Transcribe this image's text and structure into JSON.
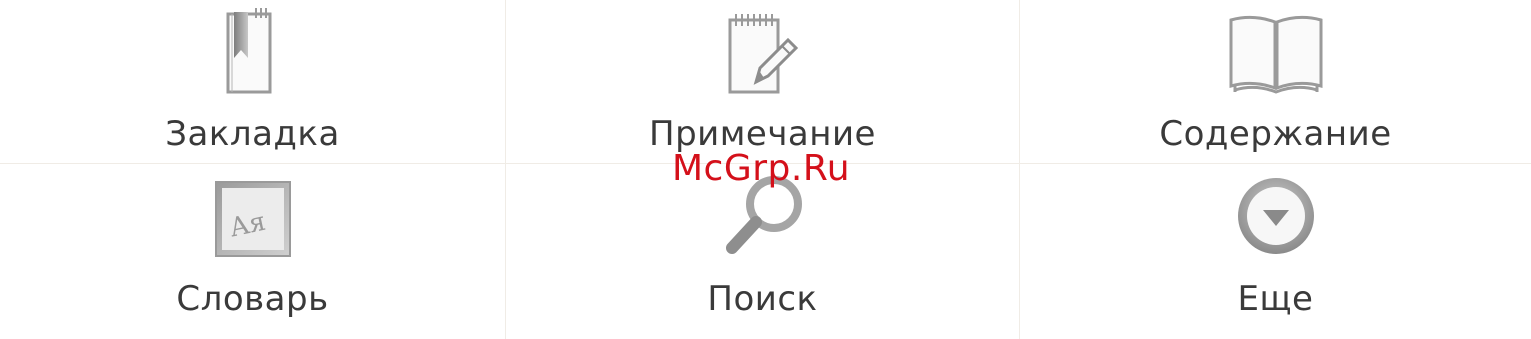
{
  "menu": {
    "items": [
      {
        "label": "Закладка",
        "icon": "bookmark-icon"
      },
      {
        "label": "Примечание",
        "icon": "note-edit-icon"
      },
      {
        "label": "Содержание",
        "icon": "open-book-icon"
      },
      {
        "label": "Словарь",
        "icon": "dictionary-icon"
      },
      {
        "label": "Поиск",
        "icon": "search-icon"
      },
      {
        "label": "Еще",
        "icon": "more-icon"
      }
    ]
  },
  "watermark": {
    "text": "McGrp.Ru",
    "color": "#d4101a"
  },
  "colors": {
    "icon_gray": "#9a9a9a",
    "divider": "#f0ece6",
    "label": "#3a3a3a"
  }
}
